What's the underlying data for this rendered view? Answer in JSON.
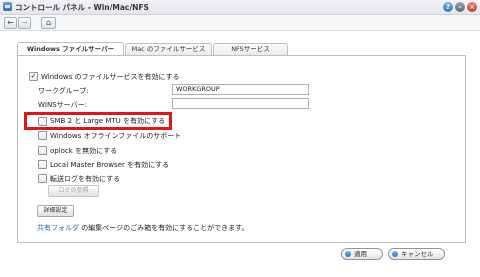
{
  "window": {
    "title": "コントロール パネル - Win/Mac/NFS",
    "help_icon": "question-icon",
    "minimize_icon": "minimize-icon",
    "close_icon": "close-icon"
  },
  "nav": {
    "back": "←",
    "forward": "→",
    "home": "⌂"
  },
  "tabs": [
    {
      "label": "Windows ファイルサーバー",
      "active": true
    },
    {
      "label": "Mac のファイルサービス",
      "active": false
    },
    {
      "label": "NFSサービス",
      "active": false
    }
  ],
  "form": {
    "enable_windows": {
      "label": "Windows のファイルサービスを有効にする",
      "checked": true
    },
    "workgroup": {
      "label": "ワークグループ:",
      "value": "WORKGROUP"
    },
    "wins": {
      "label": "WINSサーバー:",
      "value": ""
    },
    "smb2": {
      "label": "SMB 2 と Large MTU を有効にする",
      "checked": false
    },
    "offline_files": {
      "label": "Windows オフラインファイルのサポート",
      "checked": false
    },
    "oplock": {
      "label": "oplock を無効にする",
      "checked": false
    },
    "local_master": {
      "label": "Local Master Browser を有効にする",
      "checked": false
    },
    "transfer_log": {
      "label": "転送ログを有効にする",
      "checked": false
    },
    "view_log_button": "ログの参照",
    "advanced_button": "詳細設定",
    "note_link": "共有フォルダ",
    "note_text": " の編集ページのごみ箱を有効にすることができます。"
  },
  "footer": {
    "apply": "適用",
    "cancel": "キャンセル"
  },
  "colors": {
    "highlight": "#e0151b",
    "link": "#2a6bc2"
  }
}
